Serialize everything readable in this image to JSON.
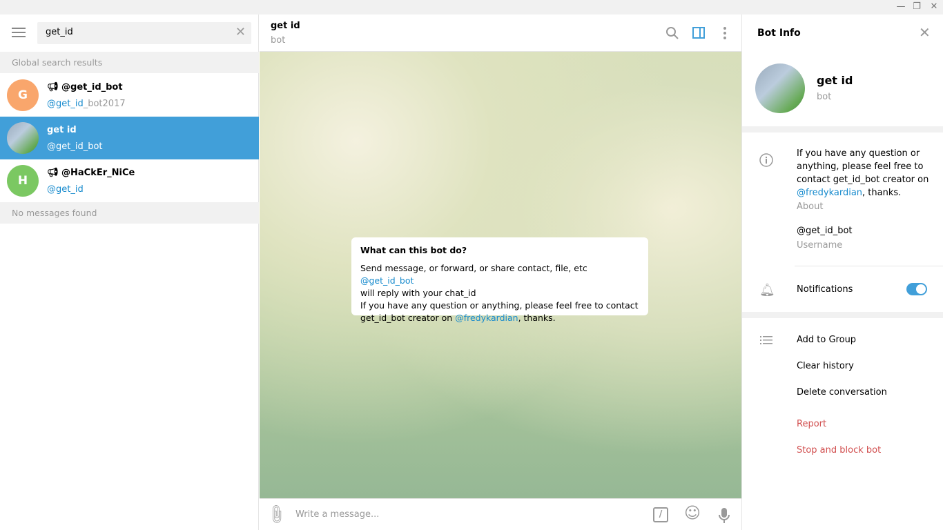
{
  "window": {
    "minimize": "—",
    "restore": "❐",
    "close": "✕"
  },
  "search": {
    "value": "get_id",
    "clear": "✕"
  },
  "left": {
    "global_header": "Global search results",
    "results": [
      {
        "avatar_letter": "G",
        "avatar_color": "#f9a66c",
        "title": "@get_id_bot",
        "channel": true,
        "sub_highlight": "@get_id",
        "sub_rest": "_bot2017"
      },
      {
        "avatar_letter": "",
        "avatar_color": "",
        "title": "get id",
        "channel": false,
        "sub_highlight": "@get_id_bot",
        "sub_rest": "",
        "selected": true
      },
      {
        "avatar_letter": "H",
        "avatar_color": "#7bc862",
        "title": "@HaCkEr_NiCe",
        "channel": true,
        "sub_highlight": "@get_id",
        "sub_rest": ""
      }
    ],
    "no_messages": "No messages found"
  },
  "chat": {
    "title": "get id",
    "status": "bot",
    "card": {
      "title": "What can this bot do?",
      "line1": "Send message, or forward, or share contact, file, etc ",
      "line1_link": "@get_id_bot",
      "line2": "will reply with your chat_id",
      "line3": "If you have any question or anything, please feel free to contact",
      "line4": "get_id_bot creator on ",
      "line4_link": "@fredykardian",
      "line4_end": ", thanks."
    },
    "input_placeholder": "Write a message...",
    "commands_icon": "/"
  },
  "info": {
    "title": "Bot Info",
    "close": "✕",
    "name": "get id",
    "status": "bot",
    "about_text": "If you have any question or anything, please feel free to contact get_id_bot creator on ",
    "about_link": "@fredykardian",
    "about_end": ", thanks.",
    "about_label": "About",
    "username": "@get_id_bot",
    "username_label": "Username",
    "notifications": "Notifications",
    "notifications_on": true,
    "actions": {
      "add": "Add to Group",
      "clear": "Clear history",
      "delete": "Delete conversation",
      "report": "Report",
      "stop": "Stop and block bot"
    },
    "accent": "#419fd9"
  }
}
